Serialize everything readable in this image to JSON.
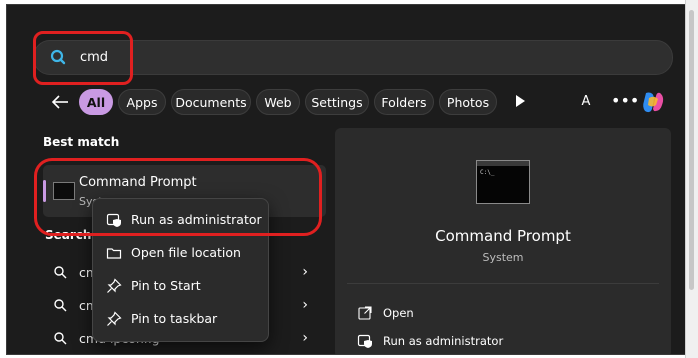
{
  "search": {
    "value": "cmd"
  },
  "filters": [
    {
      "label": "All",
      "active": true
    },
    {
      "label": "Apps"
    },
    {
      "label": "Documents"
    },
    {
      "label": "Web"
    },
    {
      "label": "Settings"
    },
    {
      "label": "Folders"
    },
    {
      "label": "Photos"
    }
  ],
  "account_initial": "A",
  "more_label": "•••",
  "best_match": {
    "heading": "Best match",
    "title": "Command Prompt",
    "subtitle_visible": "Syst"
  },
  "search_section": {
    "heading_visible": "Search"
  },
  "results": [
    {
      "label": "cm"
    },
    {
      "label": "cm"
    },
    {
      "label": "cmd ipconfig"
    }
  ],
  "context_menu": [
    {
      "label": "Run as administrator",
      "icon": "shield-admin-icon"
    },
    {
      "label": "Open file location",
      "icon": "folder-icon"
    },
    {
      "label": "Pin to Start",
      "icon": "pin-icon"
    },
    {
      "label": "Pin to taskbar",
      "icon": "pin-icon"
    }
  ],
  "detail": {
    "name": "Command Prompt",
    "kind": "System",
    "actions": [
      {
        "label": "Open",
        "icon": "open-external-icon"
      },
      {
        "label": "Run as administrator",
        "icon": "shield-admin-icon"
      }
    ]
  },
  "colors": {
    "accent": "#c99ae3",
    "annotation": "#e02020",
    "background": "#1c1c1c"
  }
}
